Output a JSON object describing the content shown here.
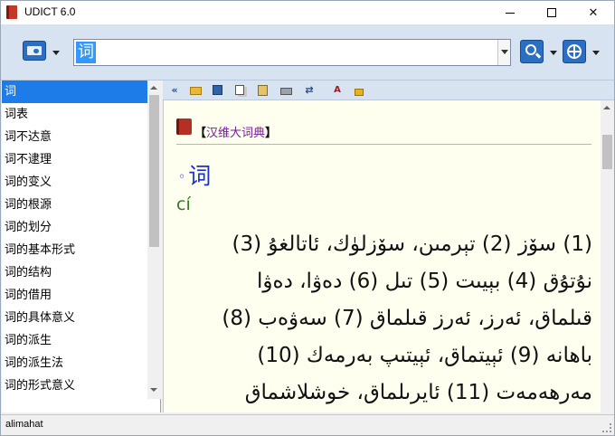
{
  "window": {
    "title": "UDICT 6.0"
  },
  "search": {
    "value": "词"
  },
  "word_list": [
    "词",
    "词表",
    "词不达意",
    "词不逮理",
    "词的变义",
    "词的根源",
    "词的划分",
    "词的基本形式",
    "词的结构",
    "词的借用",
    "词的具体意义",
    "词的派生",
    "词的派生法",
    "词的形式意义"
  ],
  "selected_index": 0,
  "entry": {
    "dictionary": "汉维大词典",
    "bracket_open": "【",
    "bracket_close": "】",
    "bullet": "◦",
    "headword": "词",
    "pinyin": "cí",
    "definition_lines": [
      "(1) سۆز (2) تېرمىن، سۆزلۈك، ئاتالغۇ (3)",
      "نۇتۇق (4) بېيىت (5) تىل (6) دەۋا، دەۋا",
      "قىلماق، ئەرز، ئەرز قىلماق (7) سەۋەب (8)",
      "باھانە (9) ئېيتماق، ئېيتىپ بەرمەك (10)",
      "مەرھەمەت (11) ئايرىلماق، خوشلاشماق"
    ]
  },
  "status": {
    "text": "alimahat"
  },
  "icons": {
    "toolbar": [
      "back-icon",
      "open-folder-icon",
      "save-icon",
      "copy-icon",
      "paste-icon",
      "print-icon",
      "swap-icon",
      "font-icon",
      "lock-icon"
    ]
  },
  "colors": {
    "accent": "#1e7ce8",
    "toolbar_bg": "#d7e3f1",
    "content_bg": "#fffff0",
    "headword": "#1a2fd0",
    "pinyin": "#2e7d1f",
    "dict_name": "#7a1c9c"
  }
}
